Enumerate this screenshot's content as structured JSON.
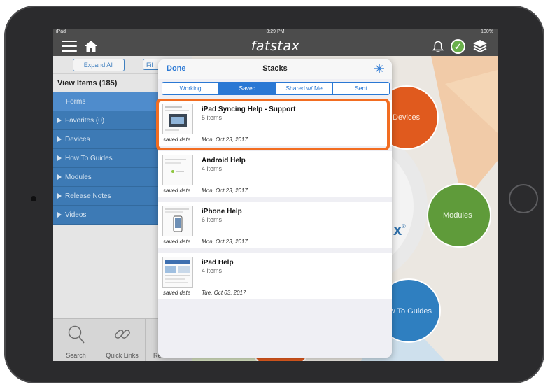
{
  "statusbar": {
    "device": "iPad",
    "time": "3:29 PM",
    "battery": "100%"
  },
  "navbar": {
    "logo_text": "fatstax"
  },
  "left_panel": {
    "expand_all_label": "Expand All",
    "filter_label": "Fil",
    "view_items_title": "View Items (185)",
    "items": [
      {
        "label": "Forms"
      },
      {
        "label": "Favorites (0)"
      },
      {
        "label": "Devices"
      },
      {
        "label": "How To Guides"
      },
      {
        "label": "Modules"
      },
      {
        "label": "Release Notes"
      },
      {
        "label": "Videos"
      }
    ],
    "toolbar": [
      {
        "label": "Search"
      },
      {
        "label": "Quick Links"
      },
      {
        "label": "Resources"
      }
    ]
  },
  "background": {
    "devices_label": "Devices",
    "modules_label": "Modules",
    "howto_label": "How To Guides"
  },
  "modal": {
    "done_label": "Done",
    "title": "Stacks",
    "tabs": [
      {
        "label": "Working"
      },
      {
        "label": "Saved",
        "active": true
      },
      {
        "label": "Shared w/ Me"
      },
      {
        "label": "Sent"
      }
    ],
    "rows": [
      {
        "title": "iPad Syncing Help - Support",
        "count": "5 items",
        "saved_label": "saved date",
        "date": "Mon, Oct 23, 2017"
      },
      {
        "title": "Android Help",
        "count": "4 items",
        "saved_label": "saved date",
        "date": "Mon, Oct 23, 2017"
      },
      {
        "title": "iPhone Help",
        "count": "6 items",
        "saved_label": "saved date",
        "date": "Mon, Oct 23, 2017"
      },
      {
        "title": "iPad Help",
        "count": "4 items",
        "saved_label": "saved date",
        "date": "Tue, Oct 03, 2017"
      }
    ]
  },
  "colors": {
    "accent": "#2a78d4",
    "nav_blue": "#3d7ab5",
    "highlight": "#f26d21",
    "devices_circle": "#e05a1e",
    "modules_circle": "#5f9b3a",
    "howto_circle": "#2f7fc0"
  }
}
